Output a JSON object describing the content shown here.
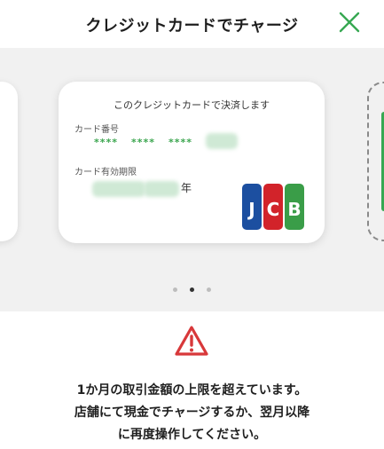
{
  "header": {
    "title": "クレジットカードでチャージ",
    "close_icon": "close-icon",
    "accent_color": "#37a852"
  },
  "card": {
    "heading": "このクレジットカードで決済します",
    "number_label": "カード番号",
    "number_groups": [
      "****",
      "****",
      "****"
    ],
    "expiry_label": "カード有効期限",
    "expiry_suffix": "年",
    "brand": "JCB"
  },
  "carousel": {
    "page_count": 3,
    "active_page": 2
  },
  "warning": {
    "icon": "warning-triangle-icon",
    "icon_color": "#d8383a",
    "lines": [
      "1か月の取引金額の上限を超えています。",
      "店舗にて現金でチャージするか、翌月以降",
      "に再度操作してください。"
    ]
  }
}
